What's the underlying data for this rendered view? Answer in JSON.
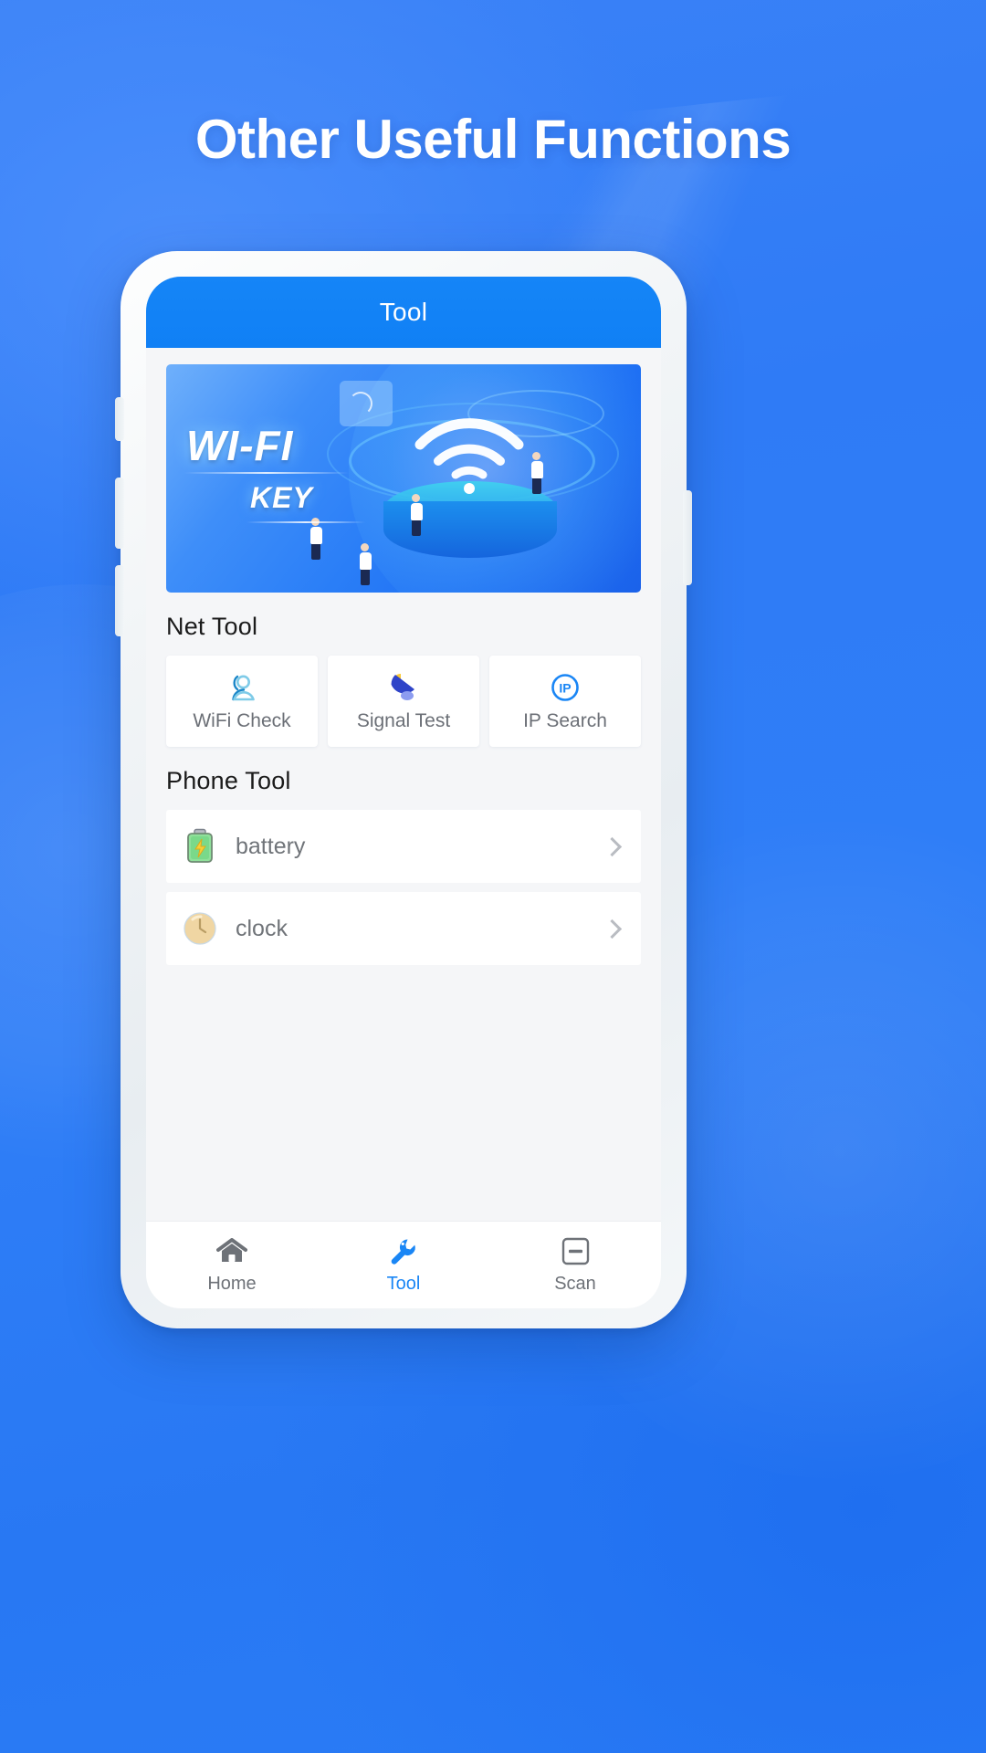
{
  "page": {
    "title": "Other Useful Functions",
    "background_color": "#2979f5"
  },
  "phone": {
    "app_bar": {
      "title": "Tool",
      "background_color": "#1080f5",
      "text_color": "#ffffff"
    },
    "banner": {
      "title": "WI-FI",
      "subtitle": "KEY",
      "icon": "wifi-signal-icon"
    },
    "sections": [
      {
        "heading": "Net Tool",
        "type": "grid",
        "items": [
          {
            "label": "WiFi Check",
            "icon": "user-person-icon",
            "accent": "#6cc3e8"
          },
          {
            "label": "Signal Test",
            "icon": "satellite-dish-icon",
            "accent": "#2f44c8"
          },
          {
            "label": "IP Search",
            "icon": "ip-circle-icon",
            "accent": "#1a86f5"
          }
        ]
      },
      {
        "heading": "Phone Tool",
        "type": "list",
        "items": [
          {
            "label": "battery",
            "icon": "battery-icon",
            "accent": "#77dd77",
            "chevron": "chevron-right-icon"
          },
          {
            "label": "clock",
            "icon": "clock-icon",
            "accent": "#efd5a0",
            "chevron": "chevron-right-icon"
          }
        ]
      }
    ],
    "bottom_nav": {
      "active_color": "#1a86f5",
      "inactive_color": "#6e7278",
      "items": [
        {
          "label": "Home",
          "icon": "home-icon",
          "active": false
        },
        {
          "label": "Tool",
          "icon": "wrench-icon",
          "active": true
        },
        {
          "label": "Scan",
          "icon": "scan-icon",
          "active": false
        }
      ]
    }
  }
}
